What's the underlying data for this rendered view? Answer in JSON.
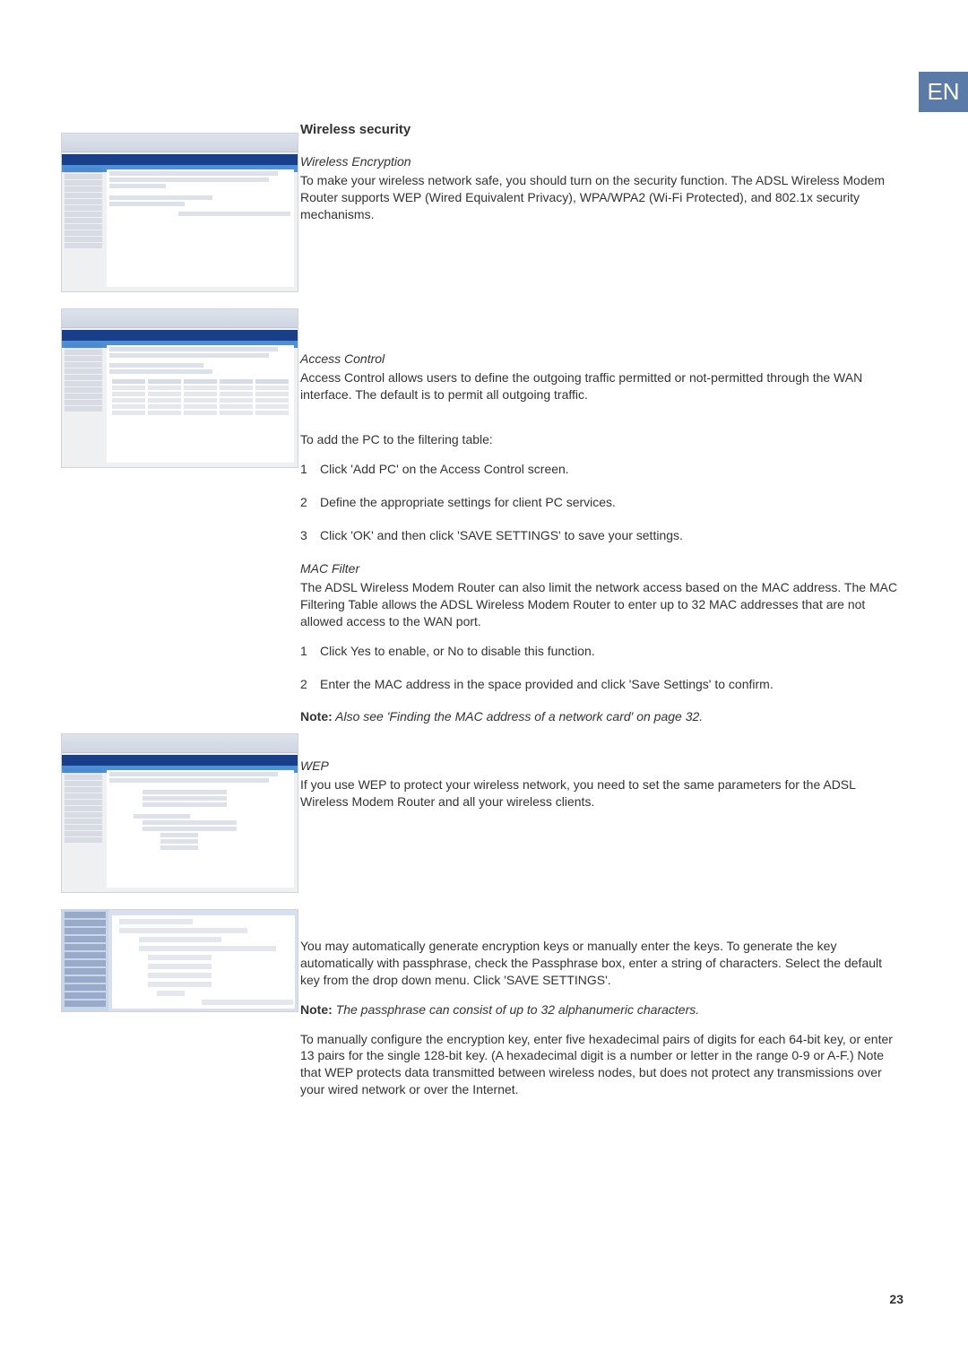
{
  "lang_tab": "EN",
  "page_number": "23",
  "section_title": "Wireless security",
  "wireless_encryption": {
    "heading": "Wireless Encryption",
    "body": "To make your wireless network safe, you should turn on the security function. The ADSL Wireless Modem Router supports WEP (Wired Equivalent Privacy), WPA/WPA2 (Wi-Fi Protected), and 802.1x security mechanisms."
  },
  "access_control": {
    "heading": "Access Control",
    "intro": "Access Control allows users to define the outgoing traffic permitted or not-permitted through the WAN interface. The default is to permit all outgoing traffic.",
    "lead_in": "To add the PC to the filtering table:",
    "steps": [
      "Click 'Add PC' on the Access Control screen.",
      "Define the appropriate settings for client PC services.",
      "Click 'OK' and then click 'SAVE SETTINGS' to save your settings."
    ]
  },
  "mac_filter": {
    "heading": "MAC Filter",
    "body": "The ADSL Wireless Modem Router can also limit the network access based on the MAC address. The MAC Filtering Table allows the ADSL Wireless Modem Router to enter up to 32 MAC addresses that are not allowed access to the WAN port.",
    "steps": [
      "Click Yes to enable, or No to disable this function.",
      "Enter the MAC address in the space provided and click 'Save Settings' to confirm."
    ],
    "note_label": "Note:",
    "note_body": " Also see 'Finding the MAC address of a network card' on page 32."
  },
  "wep": {
    "heading": "WEP",
    "intro": "If you use WEP to protect your wireless network, you need to set the same parameters for the ADSL Wireless Modem Router and all your wireless clients.",
    "body1": "You may automatically generate encryption keys or manually enter the keys. To generate the key automatically with passphrase, check the Passphrase box, enter a string of characters. Select the default key from the drop down menu. Click 'SAVE SETTINGS'.",
    "note_label": "Note:",
    "note_body": " The passphrase can consist of up to 32 alphanumeric characters.",
    "body2": "To manually configure the encryption key, enter five hexadecimal pairs of digits for each 64-bit key, or enter 13 pairs for the single 128-bit key. (A hexadecimal digit is a number or letter in the range 0-9 or A-F.) Note that WEP protects data transmitted between wireless nodes, but does not protect any transmissions over your wired network or over the Internet."
  }
}
